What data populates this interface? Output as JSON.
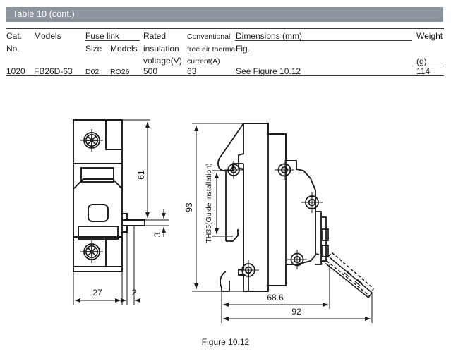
{
  "table": {
    "caption": "Table 10 (cont.)",
    "headers": {
      "cat_no_line1": "Cat.",
      "cat_no_line2": "No.",
      "models": "Models",
      "fuse_link_group": "Fuse link",
      "fuse_link_size": "Size",
      "fuse_link_models": "Models",
      "rated_line1": "Rated",
      "rated_line2": "insulation",
      "rated_line3": "voltage(V)",
      "conventional_line1": "Conventional",
      "conventional_line2": "free air thermal",
      "conventional_line3": "current(A)",
      "dimensions_group": "Dimensions (mm)",
      "dimensions_fig": "Fig.",
      "weight": "Weight",
      "weight_unit": "(g)"
    },
    "rows": [
      {
        "cat_no": "1020",
        "models": "FB26D-63",
        "fuse_size": "D02",
        "fuse_models": "RO26",
        "rated_voltage": "500",
        "thermal_current": "63",
        "dimensions": "See Figure 10.12",
        "weight": "114"
      }
    ]
  },
  "figure": {
    "caption": "Figure 10.12",
    "front_view": {
      "dim_height": "61",
      "dim_terminal": "3",
      "dim_width": "27",
      "dim_lug": "2"
    },
    "side_view": {
      "dim_total_height": "93",
      "label_rail": "TH35(Guide installation)",
      "dim_body_depth": "68.6",
      "dim_total_depth": "92"
    }
  },
  "colors": {
    "header_band": "#8c959d",
    "header_text": "#ffffff",
    "rule": "#3a3a3a",
    "line": "#1a1a1a",
    "page_bg": "#ffffff"
  }
}
